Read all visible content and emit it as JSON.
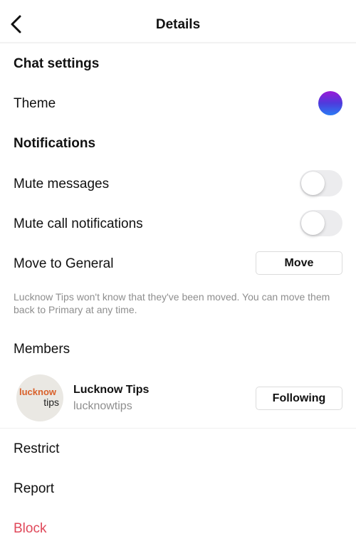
{
  "header": {
    "title": "Details",
    "back_icon": "chevron-left-icon"
  },
  "chat_settings": {
    "title": "Chat settings",
    "theme": {
      "label": "Theme",
      "colors": [
        "#9a1ad6",
        "#4e3bdc",
        "#2a7cf4"
      ]
    }
  },
  "notifications": {
    "title": "Notifications",
    "mute_messages": {
      "label": "Mute messages",
      "on": false
    },
    "mute_calls": {
      "label": "Mute call notifications",
      "on": false
    }
  },
  "move": {
    "label": "Move to General",
    "button": "Move",
    "note": "Lucknow Tips won't know that they've been moved. You can move them back to Primary at any time."
  },
  "members": {
    "title": "Members",
    "items": [
      {
        "name": "Lucknow Tips",
        "handle": "lucknowtips",
        "avatar_text_top": "lucknow",
        "avatar_text_bottom": "tips",
        "button": "Following"
      }
    ]
  },
  "actions": {
    "restrict": "Restrict",
    "report": "Report",
    "block": "Block"
  },
  "colors": {
    "danger": "#e0485a",
    "secondary_text": "#8e8e8e"
  }
}
